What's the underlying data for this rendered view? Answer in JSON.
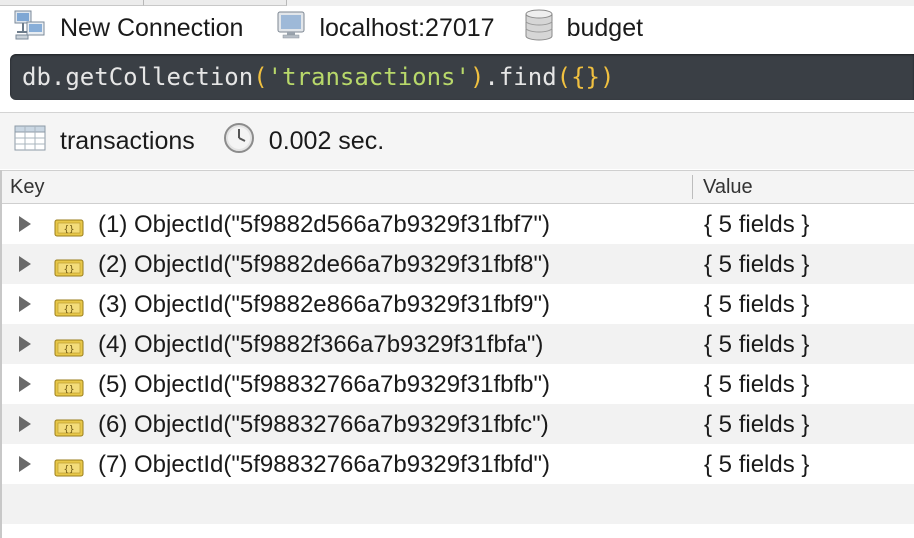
{
  "connection_bar": {
    "connection_name": "New Connection",
    "server": "localhost:27017",
    "database": "budget"
  },
  "query": {
    "db": "db",
    "dot1": ".",
    "method": "getCollection",
    "open_paren": "(",
    "collection_arg": "'transactions'",
    "close_paren": ")",
    "dot2": ".",
    "find": "find",
    "find_args": "({})"
  },
  "result_bar": {
    "collection": "transactions",
    "time": "0.002 sec."
  },
  "table": {
    "columns": {
      "key": "Key",
      "value": "Value"
    },
    "rows": [
      {
        "key": "(1) ObjectId(\"5f9882d566a7b9329f31fbf7\")",
        "value": "{ 5 fields }"
      },
      {
        "key": "(2) ObjectId(\"5f9882de66a7b9329f31fbf8\")",
        "value": "{ 5 fields }"
      },
      {
        "key": "(3) ObjectId(\"5f9882e866a7b9329f31fbf9\")",
        "value": "{ 5 fields }"
      },
      {
        "key": "(4) ObjectId(\"5f9882f366a7b9329f31fbfa\")",
        "value": "{ 5 fields }"
      },
      {
        "key": "(5) ObjectId(\"5f98832766a7b9329f31fbfb\")",
        "value": "{ 5 fields }"
      },
      {
        "key": "(6) ObjectId(\"5f98832766a7b9329f31fbfc\")",
        "value": "{ 5 fields }"
      },
      {
        "key": "(7) ObjectId(\"5f98832766a7b9329f31fbfd\")",
        "value": "{ 5 fields }"
      }
    ]
  },
  "icons": {
    "connection": "network-computers-icon",
    "server": "monitor-icon",
    "database": "database-cylinder-icon",
    "collection": "table-grid-icon",
    "time": "clock-icon",
    "row_expand": "disclosure-triangle-icon",
    "row_type": "objectid-icon"
  },
  "colors": {
    "query_bg": "#3a3f45",
    "string_literal": "#b8d86a",
    "bracket": "#f0c040",
    "objectid_icon": "#e8c84a"
  }
}
